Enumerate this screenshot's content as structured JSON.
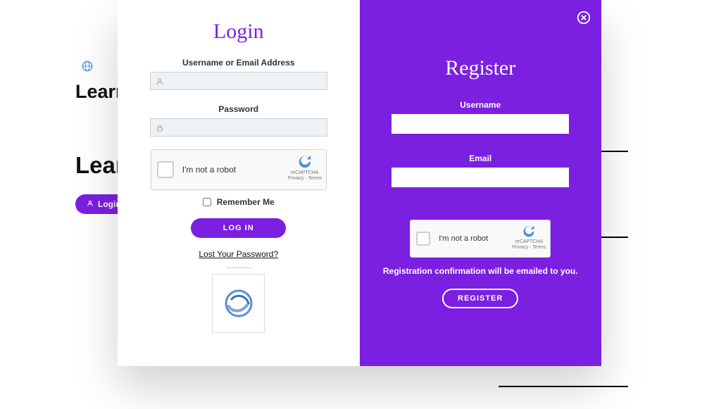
{
  "background": {
    "heading_a": "Learn",
    "heading_b": "Lear",
    "login_pill": "Login"
  },
  "login": {
    "title": "Login",
    "username_label": "Username or Email Address",
    "password_label": "Password",
    "recaptcha_text": "I'm not a robot",
    "recaptcha_brand": "reCAPTCHA",
    "recaptcha_terms": "Privacy - Terms",
    "remember_label": "Remember Me",
    "button": "LOG IN",
    "lost_password": "Lost Your Password?"
  },
  "register": {
    "title": "Register",
    "username_label": "Username",
    "email_label": "Email",
    "recaptcha_text": "I'm not a robot",
    "recaptcha_brand": "reCAPTCHA",
    "recaptcha_terms": "Privacy - Terms",
    "confirmation": "Registration confirmation will be emailed to you.",
    "button": "REGISTER"
  },
  "colors": {
    "accent": "#7b1fe0"
  }
}
